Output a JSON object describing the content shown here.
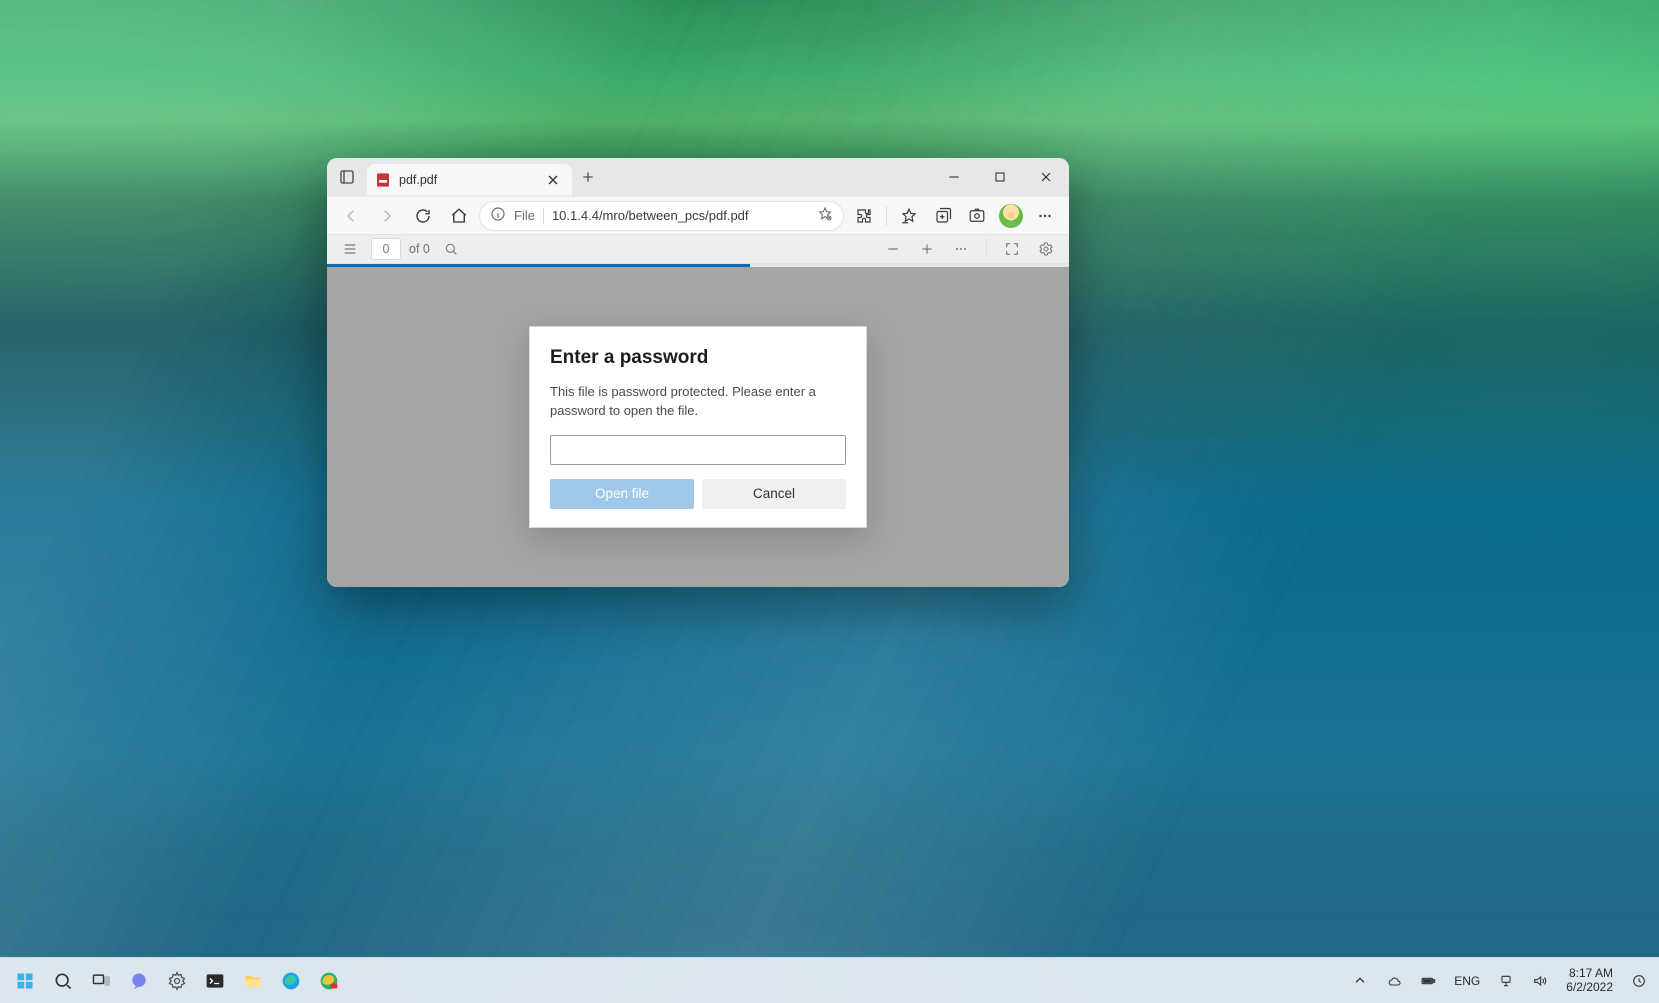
{
  "browser": {
    "tab_title": "pdf.pdf",
    "address": {
      "protocol_label": "File",
      "url": "10.1.4.4/mro/between_pcs/pdf.pdf"
    },
    "pdf": {
      "page_current": "0",
      "page_of_label": "of 0",
      "progress_percent": 57
    },
    "dialog": {
      "title": "Enter a password",
      "message": "This file is password protected. Please enter a password to open the file.",
      "password_value": "",
      "open_label": "Open file",
      "cancel_label": "Cancel"
    }
  },
  "taskbar": {
    "lang": "ENG",
    "time": "8:17 AM",
    "date": "6/2/2022"
  }
}
